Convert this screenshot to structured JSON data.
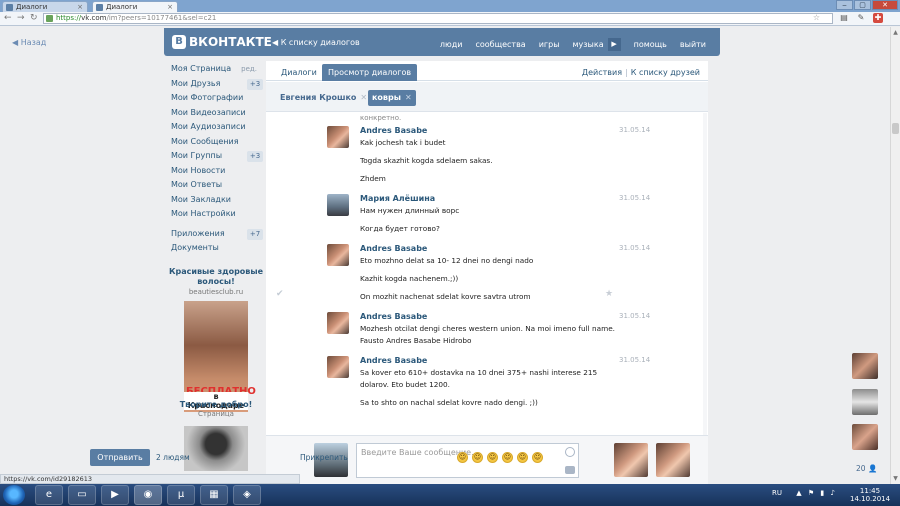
{
  "browser": {
    "tabs": [
      {
        "label": "Диалоги"
      },
      {
        "label": "Диалоги"
      }
    ],
    "url_scheme": "https://",
    "url_host": "vk.com",
    "url_rest": "/im?peers=10177461&sel=c21",
    "window_buttons": [
      "‒",
      "▢",
      "✕"
    ],
    "status_url": "https://vk.com/id29182613"
  },
  "header": {
    "back_label": "Назад",
    "logo_text": "ВКОНТАКТЕ",
    "logo_letter": "В",
    "crumb": "К списку диалогов",
    "nav": [
      "люди",
      "сообщества",
      "игры",
      "музыка",
      "помощь",
      "выйти"
    ]
  },
  "sidebar": {
    "items": [
      {
        "label": "Моя Страница",
        "extra": "ред."
      },
      {
        "label": "Мои Друзья",
        "badge": "+3"
      },
      {
        "label": "Мои Фотографии"
      },
      {
        "label": "Мои Видеозаписи"
      },
      {
        "label": "Мои Аудиозаписи"
      },
      {
        "label": "Мои Сообщения"
      },
      {
        "label": "Мои Группы",
        "badge": "+3"
      },
      {
        "label": "Мои Новости"
      },
      {
        "label": "Мои Ответы"
      },
      {
        "label": "Мои Закладки"
      },
      {
        "label": "Мои Настройки"
      }
    ],
    "items2": [
      {
        "label": "Приложения",
        "badge": "+7"
      },
      {
        "label": "Документы"
      }
    ]
  },
  "ads": {
    "ad1_title": "Красивые здоровые волосы!",
    "ad1_site": "beautiesclub.ru",
    "ad1_banner_top": "БЕСПЛАТНО",
    "ad1_banner_bottom": "в Краснодаре",
    "ad2_title": "Творите добро!",
    "ad2_sub": "Страница"
  },
  "dialog": {
    "tab_dialogs": "Диалоги",
    "tab_view": "Просмотр диалогов",
    "actions": "Действия",
    "to_friends": "К списку друзей",
    "chips": [
      {
        "label": "Евгения Крошко"
      },
      {
        "label": "ковры"
      }
    ],
    "cut_text": "конкретно.",
    "messages": [
      {
        "author": "Andres Basabe",
        "date": "31.05.14",
        "lines": [
          "Kak jochesh tak i budet",
          "Togda skazhit kogda sdelaem sakas.",
          "Zhdem"
        ]
      },
      {
        "author": "Мария Алёшина",
        "date": "31.05.14",
        "lines": [
          "Нам нужен длинный ворс",
          "Когда будет готово?"
        ]
      },
      {
        "author": "Andres Basabe",
        "date": "31.05.14",
        "lines": [
          "Eto mozhno delat sa 10- 12 dnei no dengi nado",
          "Kazhit kogda nachenem.;))",
          "On mozhit nachenat sdelat kovre savtra utrom"
        ]
      },
      {
        "author": "Andres Basabe",
        "date": "31.05.14",
        "lines": [
          "Mozhesh otcilat dengi cheres western union. Na moi imeno full name.",
          "Fausto Andres Basabe Hidrobo"
        ]
      },
      {
        "author": "Andres Basabe",
        "date": "31.05.14",
        "lines": [
          "Sa kover eto 610+ dostavka na 10 dnei 375+ nashi interese 215",
          "dolarov. Eto budet 1200.",
          "Sa to shto on nachal sdelat kovre nado dengi. ;))"
        ]
      }
    ]
  },
  "composer": {
    "placeholder": "Введите Ваше сообщение..",
    "send_label": "Отправить",
    "people": "2 людям",
    "attach": "Прикрепить",
    "emoji": [
      "☺",
      "☺",
      "☺",
      "☺",
      "☺",
      "☺"
    ]
  },
  "right_panel": {
    "count": "20"
  },
  "taskbar": {
    "lang": "RU",
    "time": "11:45",
    "date": "14.10.2014"
  }
}
